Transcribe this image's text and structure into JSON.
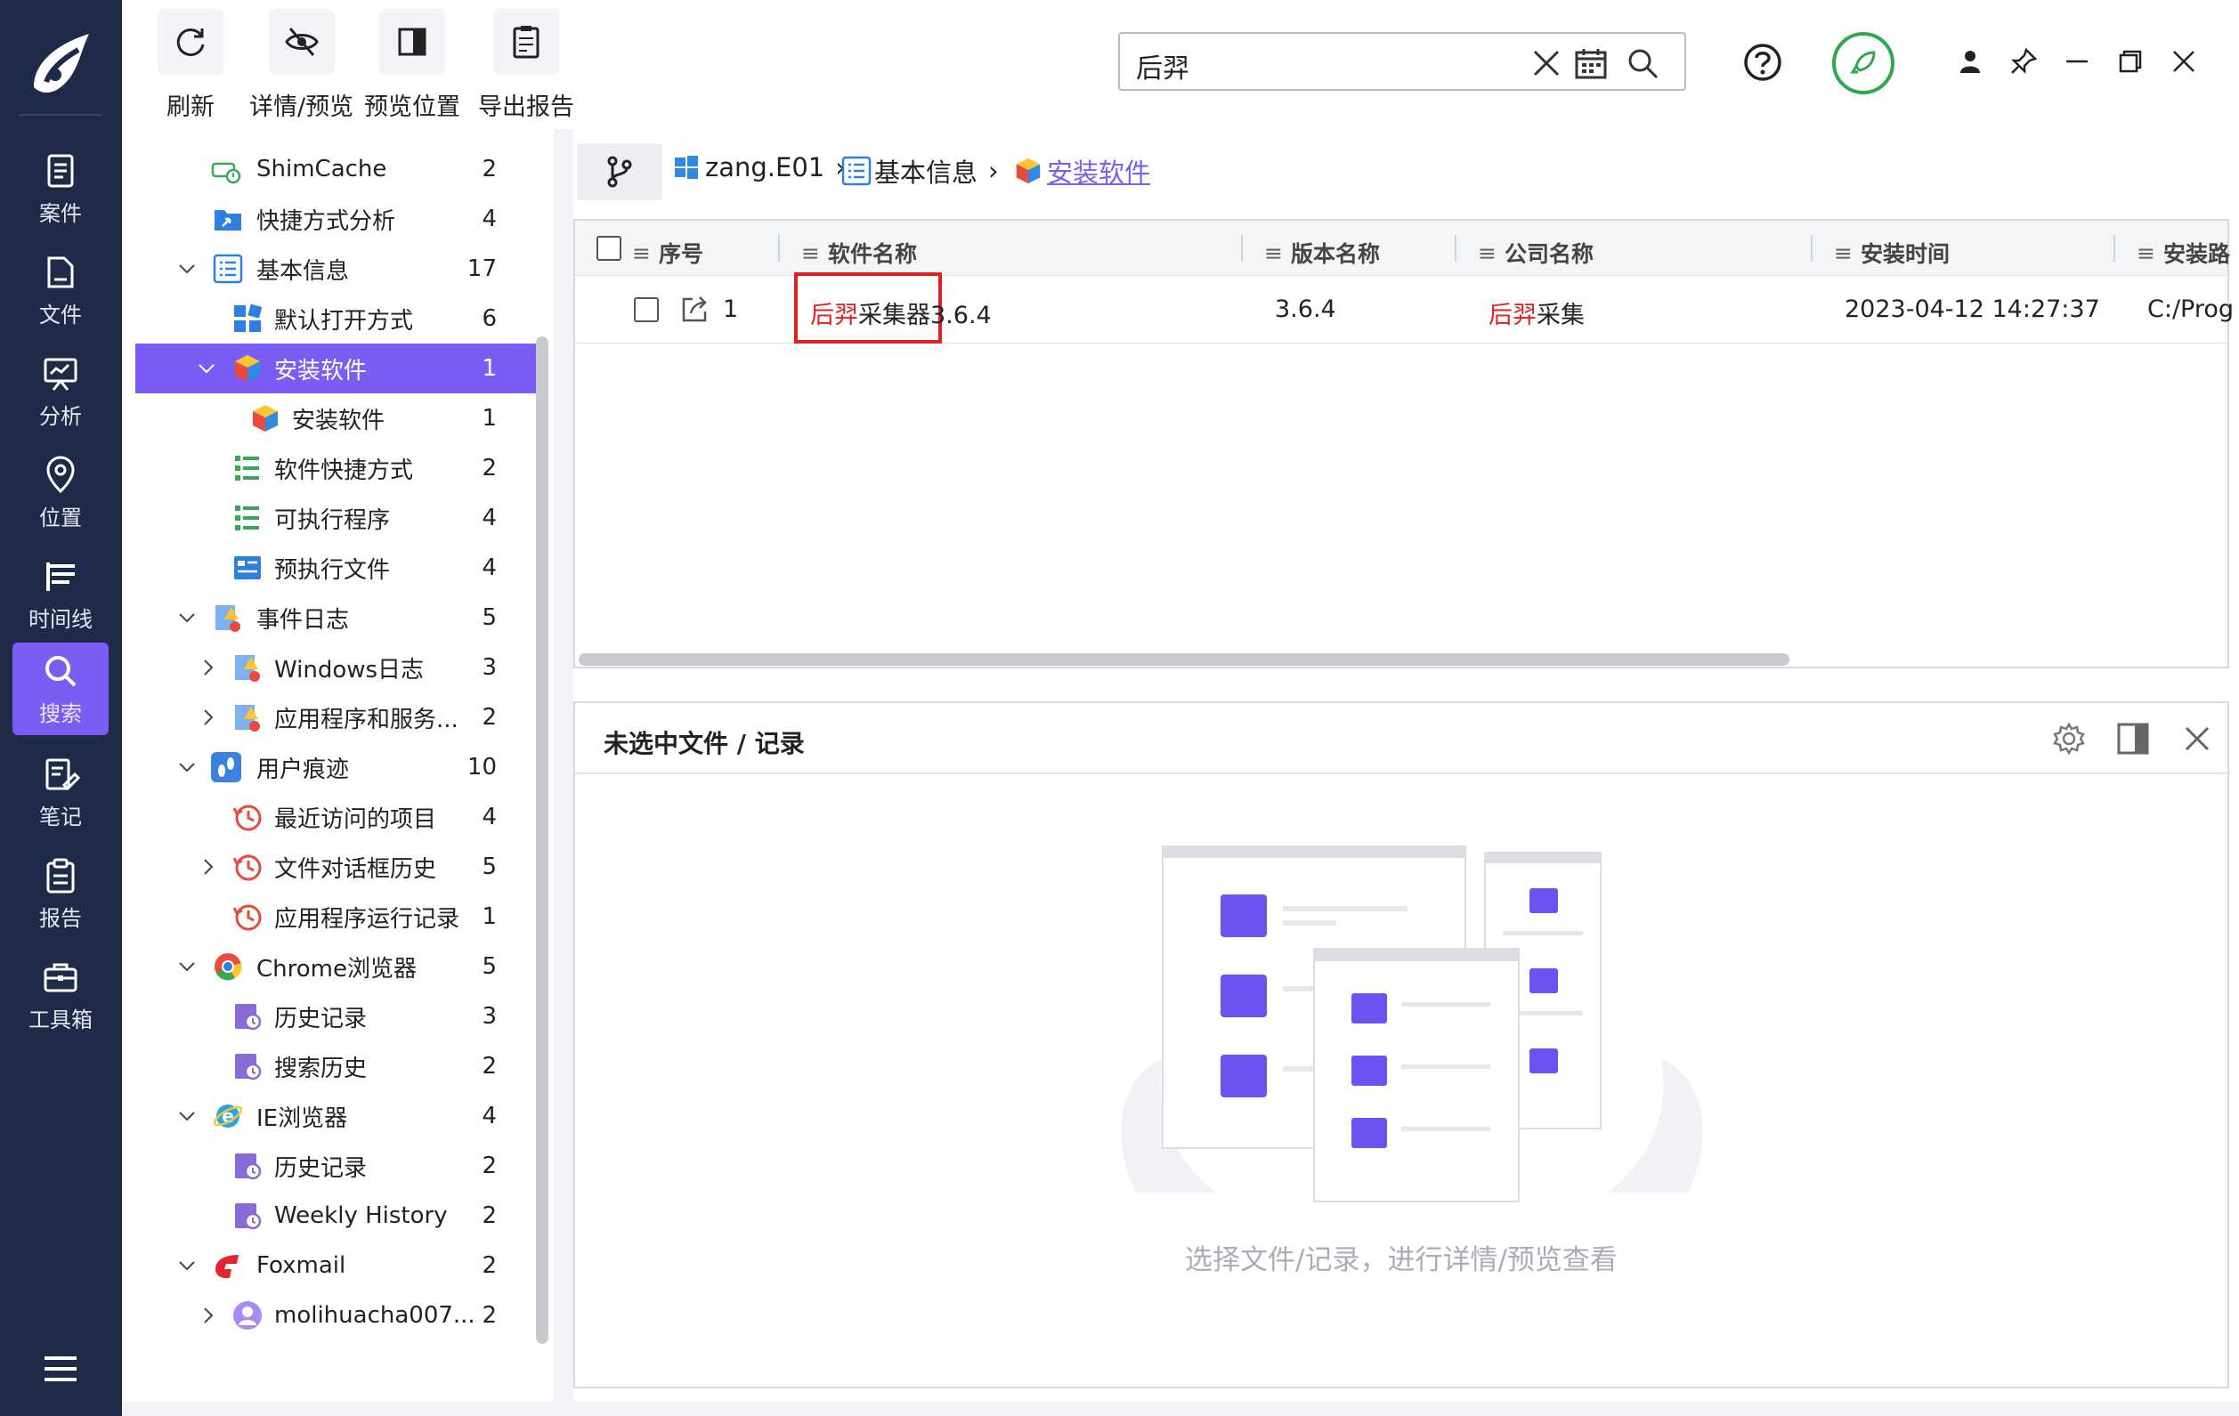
{
  "nav": {
    "items": [
      {
        "label": "案件",
        "icon": "case-icon"
      },
      {
        "label": "文件",
        "icon": "file-icon"
      },
      {
        "label": "分析",
        "icon": "analysis-icon"
      },
      {
        "label": "位置",
        "icon": "location-icon"
      },
      {
        "label": "时间线",
        "icon": "timeline-icon"
      },
      {
        "label": "搜索",
        "icon": "search-icon",
        "active": true
      },
      {
        "label": "笔记",
        "icon": "note-icon"
      },
      {
        "label": "报告",
        "icon": "report-icon"
      },
      {
        "label": "工具箱",
        "icon": "toolbox-icon"
      }
    ]
  },
  "toolbar": {
    "refresh": "刷新",
    "details": "详情/预览",
    "preview_pos": "预览位置",
    "export": "导出报告"
  },
  "search": {
    "value": "后羿"
  },
  "tree": {
    "rows": [
      {
        "label": "ShimCache",
        "count": "2"
      },
      {
        "label": "快捷方式分析",
        "count": "4"
      },
      {
        "label": "基本信息",
        "count": "17"
      },
      {
        "label": "默认打开方式",
        "count": "6"
      },
      {
        "label": "安装软件",
        "count": "1"
      },
      {
        "label": "安装软件",
        "count": "1"
      },
      {
        "label": "软件快捷方式",
        "count": "2"
      },
      {
        "label": "可执行程序",
        "count": "4"
      },
      {
        "label": "预执行文件",
        "count": "4"
      },
      {
        "label": "事件日志",
        "count": "5"
      },
      {
        "label": "Windows日志",
        "count": "3"
      },
      {
        "label": "应用程序和服务...",
        "count": "2"
      },
      {
        "label": "用户痕迹",
        "count": "10"
      },
      {
        "label": "最近访问的项目",
        "count": "4"
      },
      {
        "label": "文件对话框历史",
        "count": "5"
      },
      {
        "label": "应用程序运行记录",
        "count": "1"
      },
      {
        "label": "Chrome浏览器",
        "count": "5"
      },
      {
        "label": "历史记录",
        "count": "3"
      },
      {
        "label": "搜索历史",
        "count": "2"
      },
      {
        "label": "IE浏览器",
        "count": "4"
      },
      {
        "label": "历史记录",
        "count": "2"
      },
      {
        "label": "Weekly History",
        "count": "2"
      },
      {
        "label": "Foxmail",
        "count": "2"
      },
      {
        "label": "molihuacha007...",
        "count": "2"
      }
    ]
  },
  "breadcrumb": {
    "items": [
      "zang.E01",
      "基本信息",
      "安装软件"
    ]
  },
  "table": {
    "headers": [
      "序号",
      "软件名称",
      "版本名称",
      "公司名称",
      "安装时间",
      "安装路"
    ],
    "rows": [
      {
        "index": "1",
        "name_hl": "后羿",
        "name_rest": "采集器",
        "name_ver": "3.6.4",
        "version": "3.6.4",
        "company_hl": "后羿",
        "company_rest": "采集",
        "install_time": "2023-04-12 14:27:37",
        "path": "C:/Prog"
      }
    ]
  },
  "detail": {
    "title": "未选中文件 / 记录",
    "empty_text": "选择文件/记录，进行详情/预览查看"
  },
  "colors": {
    "rail": "#1e2a47",
    "accent": "#7b5cf5",
    "highlight": "#e02020",
    "rocket_ring": "#2ea84a"
  }
}
